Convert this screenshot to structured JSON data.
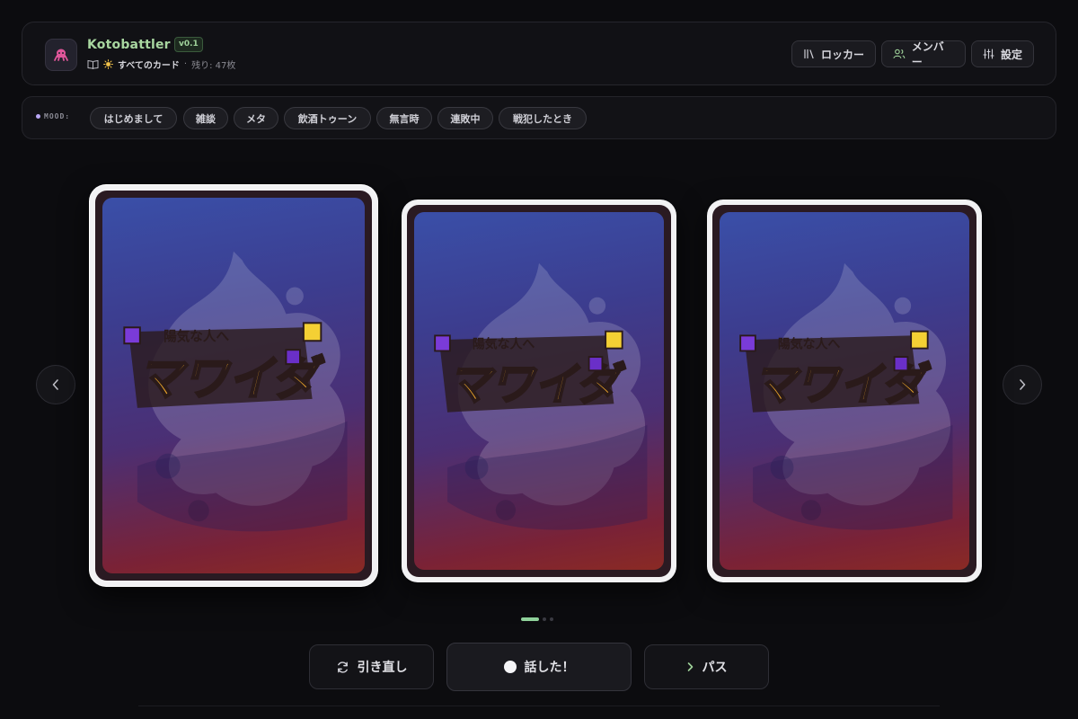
{
  "header": {
    "app_title": "Kotobattler",
    "version": "v0.1",
    "deck_name": "すべてのカード",
    "separator": "·",
    "remaining": "残り: 47枚",
    "logo_icon": "octopus-icon",
    "buttons": [
      {
        "label": "ロッカー",
        "icon": "locker-icon"
      },
      {
        "label": "メンバー",
        "icon": "members-icon"
      },
      {
        "label": "設定",
        "icon": "sliders-icon"
      }
    ]
  },
  "mood": {
    "label": "MOOD:",
    "chips": [
      "はじめまして",
      "雑談",
      "メタ",
      "飲酒トゥーン",
      "無言時",
      "連敗中",
      "戦犯したとき"
    ]
  },
  "carousel": {
    "cards": [
      {
        "state": "active"
      },
      {
        "state": "inactive"
      },
      {
        "state": "inactive"
      }
    ],
    "card_logo_ruby": "陽気な人へ",
    "card_logo_main": "マワイダ",
    "page_count": 3,
    "current_page": 1,
    "prev_icon": "chevron-left-icon",
    "next_icon": "chevron-right-icon"
  },
  "actions": {
    "redraw_label": "引き直し",
    "spoke_label": "話した！",
    "pass_label": "パス"
  },
  "colors": {
    "accent": "#8fd19a",
    "background": "#0c0c0f",
    "panel": "#111115"
  }
}
